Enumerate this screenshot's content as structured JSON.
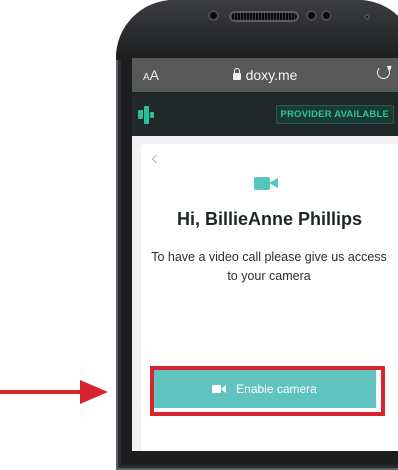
{
  "browser": {
    "text_size_label_small": "A",
    "text_size_label_large": "A",
    "url": "doxy.me"
  },
  "header": {
    "provider_status": "PROVIDER AVAILABLE"
  },
  "main": {
    "greeting": "Hi, BillieAnne Phillips",
    "message": "To have a video call please give us access to your camera",
    "enable_button_label": "Enable camera"
  },
  "colors": {
    "accent_teal": "#5fc3bf",
    "brand_green": "#29c19b",
    "header_bg": "#20282a",
    "annotation_red": "#d5232f"
  },
  "icons": [
    "lock-icon",
    "reload-icon",
    "doxy-logo-icon",
    "back-chevron-icon",
    "video-camera-icon"
  ]
}
